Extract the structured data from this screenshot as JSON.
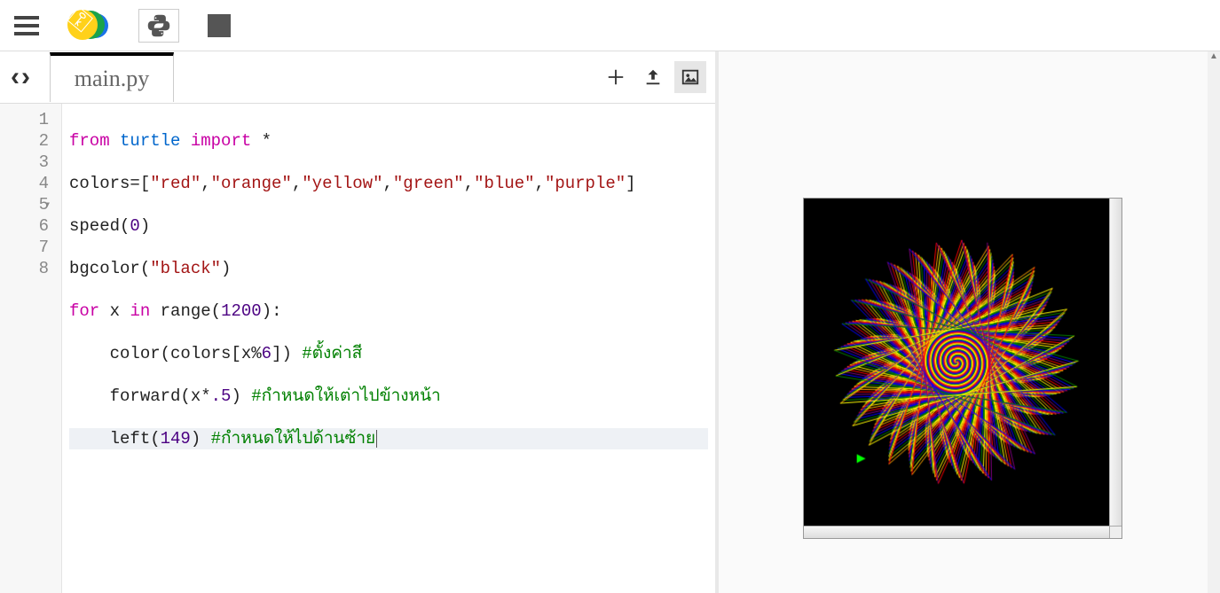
{
  "toolbar": {
    "menu_name": "main-menu",
    "logo_name": "app-logo",
    "python_name": "python-mode",
    "stop_name": "stop-square"
  },
  "tabs": {
    "back_label": "‹",
    "forward_label": "›",
    "filename": "main.py",
    "actions": {
      "add": "+",
      "upload": "⬆",
      "image": "🖼"
    }
  },
  "gutter": [
    "1",
    "2",
    "3",
    "4",
    "5",
    "6",
    "7",
    "8"
  ],
  "code": {
    "l1": {
      "from": "from",
      "mod": "turtle",
      "import": "import",
      "star": "*"
    },
    "l2": {
      "lhs": "colors=[",
      "items": [
        "\"red\"",
        "\"orange\"",
        "\"yellow\"",
        "\"green\"",
        "\"blue\"",
        "\"purple\""
      ],
      "rhs": "]"
    },
    "l3": {
      "fn": "speed(",
      "n": "0",
      "cl": ")"
    },
    "l4": {
      "fn": "bgcolor(",
      "s": "\"black\"",
      "cl": ")"
    },
    "l5": {
      "for": "for",
      "x": "x",
      "in": "in",
      "range": "range(",
      "n": "1200",
      "cl": "):"
    },
    "l6": {
      "indent": "    ",
      "fn": "color(colors[x",
      "pct": "%",
      "n": "6",
      "cl": "]) ",
      "cmt": "#ตั้งค่าสี"
    },
    "l7": {
      "indent": "    ",
      "fn": "forward(x*",
      "n": ".5",
      "cl": ") ",
      "cmt": "#กำหนดให้เต่าไปข้างหน้า"
    },
    "l8": {
      "indent": "    ",
      "fn": "left(",
      "n": "149",
      "cl": ") ",
      "cmt": "#กำหนดให้ไปด้านซ้าย"
    }
  },
  "turtle": {
    "colors": [
      "red",
      "orange",
      "yellow",
      "green",
      "blue",
      "purple"
    ],
    "angle": 149,
    "step_factor": 0.5,
    "iterations": 1200,
    "bgcolor": "black"
  }
}
